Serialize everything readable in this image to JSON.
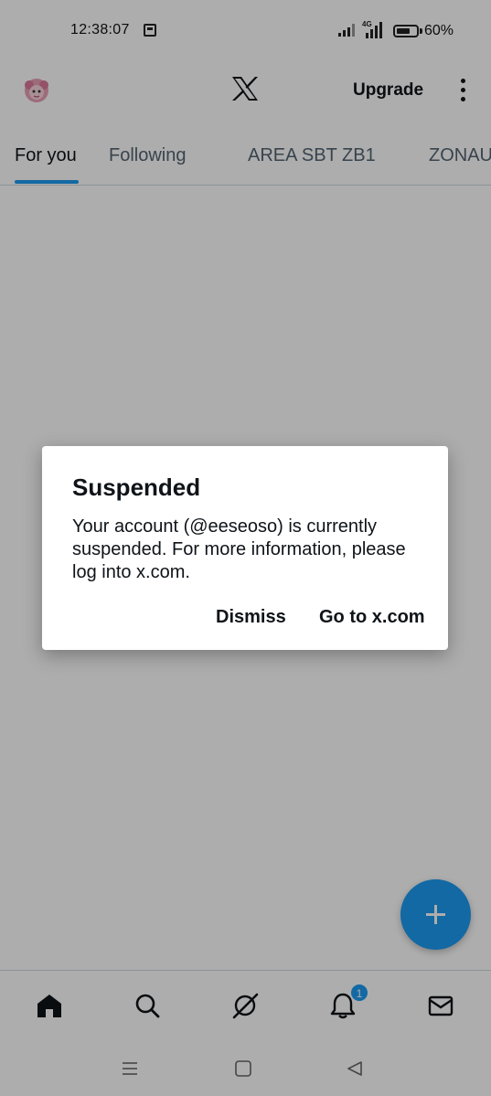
{
  "status_bar": {
    "time": "12:38:07",
    "network": "4G",
    "battery_percent": "60%",
    "battery_level": 0.6
  },
  "header": {
    "logo": "X",
    "upgrade_label": "Upgrade"
  },
  "tabs": [
    {
      "label": "For you",
      "active": true
    },
    {
      "label": "Following",
      "active": false
    },
    {
      "label": "AREA SBT ZB1",
      "active": false
    },
    {
      "label": "ZONAU",
      "active": false
    }
  ],
  "dialog": {
    "title": "Suspended",
    "body": "Your account (@eeseoso) is currently suspended. For more information, please log into x.com.",
    "dismiss_label": "Dismiss",
    "goto_label": "Go to x.com"
  },
  "bottom_nav": {
    "items": [
      "home-icon",
      "search-icon",
      "grok-icon",
      "notifications-icon",
      "messages-icon"
    ],
    "notification_count": "1"
  },
  "colors": {
    "accent": "#1d9bf0",
    "text": "#0f1419",
    "secondary_text": "#536471"
  }
}
